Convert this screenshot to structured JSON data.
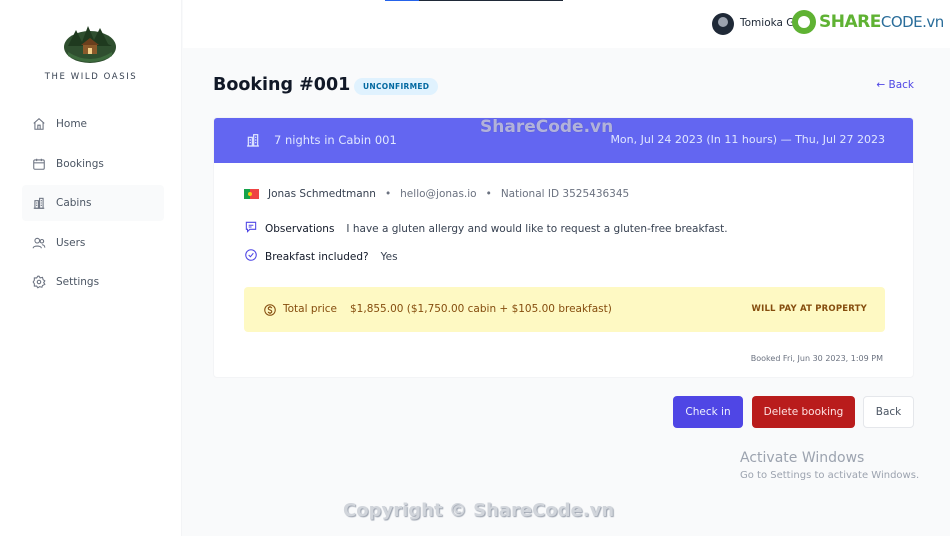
{
  "sidebar": {
    "logo_text": "THE WILD OASIS",
    "items": [
      {
        "label": "Home",
        "icon": "home-icon"
      },
      {
        "label": "Bookings",
        "icon": "calendar-icon"
      },
      {
        "label": "Cabins",
        "icon": "building-icon"
      },
      {
        "label": "Users",
        "icon": "users-icon"
      },
      {
        "label": "Settings",
        "icon": "gear-icon"
      }
    ]
  },
  "header": {
    "username": "Tomioka G"
  },
  "watermarks": {
    "brand_main": "SHARE",
    "brand_alt": "CODE.vn",
    "center": "ShareCode.vn",
    "bottom": "Copyright © ShareCode.vn"
  },
  "booking": {
    "title": "Booking #001",
    "status": "UNCONFIRMED",
    "back_link": "← Back",
    "nights_cabin": "7 nights in Cabin 001",
    "dates": "Mon, Jul 24 2023 (In 11 hours) — Thu, Jul 27 2023",
    "guest_name": "Jonas Schmedtmann",
    "guest_email": "hello@jonas.io",
    "national_id": "National ID 3525436345",
    "observations_label": "Observations",
    "observations_value": "I have a gluten allergy and would like to request a gluten-free breakfast.",
    "breakfast_label": "Breakfast included?",
    "breakfast_value": "Yes",
    "price_label": "Total price",
    "price_value": "$1,855.00 ($1,750.00 cabin + $105.00 breakfast)",
    "pay_status": "WILL PAY AT PROPERTY",
    "booked_at": "Booked Fri, Jun 30 2023, 1:09 PM"
  },
  "actions": {
    "check_in": "Check in",
    "delete": "Delete booking",
    "back": "Back"
  },
  "windows": {
    "title": "Activate Windows",
    "subtitle": "Go to Settings to activate Windows."
  },
  "colors": {
    "brand": "#4f46e5",
    "header_band": "#6366f1",
    "danger": "#b91c1c",
    "price_bg": "#fef9c3"
  }
}
